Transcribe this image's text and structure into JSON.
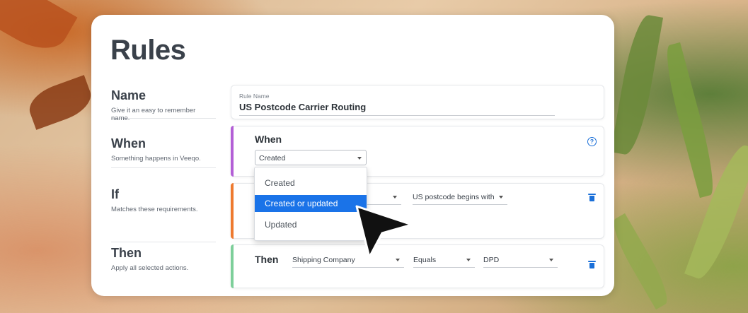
{
  "page": {
    "title": "Rules"
  },
  "sections": {
    "name": {
      "title": "Name",
      "subtitle": "Give it an easy to remember name."
    },
    "when": {
      "title": "When",
      "subtitle": "Something happens in Veeqo."
    },
    "if": {
      "title": "If",
      "subtitle": "Matches these requirements."
    },
    "then": {
      "title": "Then",
      "subtitle": "Apply all selected actions."
    }
  },
  "name_panel": {
    "field_label": "Rule Name",
    "field_value": "US Postcode Carrier Routing"
  },
  "when_panel": {
    "label": "When",
    "select_value": "Created",
    "dropdown_options": [
      "Created",
      "Created or updated",
      "Updated"
    ],
    "highlighted_option": "Created or updated",
    "help_icon": "question-circle-icon"
  },
  "if_panel": {
    "condition_value": "US postcode begins with"
  },
  "then_panel": {
    "label": "Then",
    "action": "Shipping Company",
    "operator": "Equals",
    "value": "DPD"
  },
  "colors": {
    "when_accent": "#b35fd6",
    "if_accent": "#ee7a2f",
    "then_accent": "#7dcf9a",
    "primary": "#1a73e8"
  }
}
